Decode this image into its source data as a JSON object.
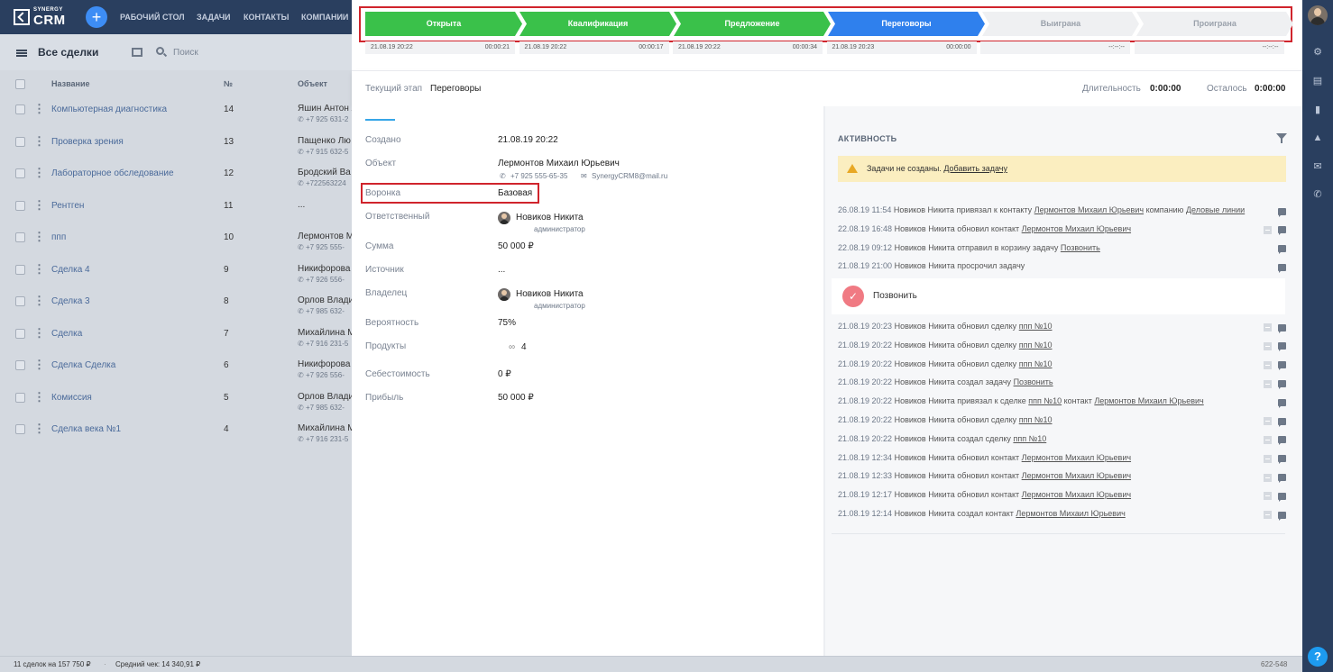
{
  "nav": {
    "logo_small": "SYNERGY",
    "logo_big": "CRM",
    "items": [
      "РАБОЧИЙ СТОЛ",
      "ЗАДАЧИ",
      "КОНТАКТЫ",
      "КОМПАНИИ"
    ]
  },
  "list": {
    "title": "Все сделки",
    "search_placeholder": "Поиск",
    "columns": [
      "Название",
      "№",
      "Объект"
    ],
    "rows": [
      {
        "name": "Компьютерная диагностика",
        "num": "14",
        "object": "Яшин Антон А",
        "phone": "+7 925 631-2"
      },
      {
        "name": "Проверка зрения",
        "num": "13",
        "object": "Пащенко Лю",
        "phone": "+7 915 632-5"
      },
      {
        "name": "Лабораторное обследование",
        "num": "12",
        "object": "Бродский Ва",
        "phone": "+722563224"
      },
      {
        "name": "Рентген",
        "num": "11",
        "object": "...",
        "phone": ""
      },
      {
        "name": "ппп",
        "num": "10",
        "object": "Лермонтов М",
        "phone": "+7 925 555-"
      },
      {
        "name": "Сделка 4",
        "num": "9",
        "object": "Никифорова",
        "phone": "+7 926 556-"
      },
      {
        "name": "Сделка 3",
        "num": "8",
        "object": "Орлов Влади",
        "phone": "+7 985 632-"
      },
      {
        "name": "Сделка",
        "num": "7",
        "object": "Михайлина М",
        "phone": "+7 916 231-5"
      },
      {
        "name": "Сделка Сделка",
        "num": "6",
        "object": "Никифорова",
        "phone": "+7 926 556-"
      },
      {
        "name": "Комиссия",
        "num": "5",
        "object": "Орлов Влади",
        "phone": "+7 985 632-"
      },
      {
        "name": "Сделка века №1",
        "num": "4",
        "object": "Михайлина М",
        "phone": "+7 916 231-5"
      }
    ]
  },
  "footer": {
    "summary": "11 сделок на 157 750 ₽",
    "separator": "·",
    "average": "Средний чек: 14 340,91 ₽",
    "right": "622-548"
  },
  "stages": [
    {
      "label": "Открыта",
      "time": "21.08.19 20:22",
      "duration": "00:00:21",
      "color": "#3ac14a",
      "state": "done"
    },
    {
      "label": "Квалификация",
      "time": "21.08.19 20:22",
      "duration": "00:00:17",
      "color": "#3ac14a",
      "state": "done"
    },
    {
      "label": "Предложение",
      "time": "21.08.19 20:22",
      "duration": "00:00:34",
      "color": "#3ac14a",
      "state": "done"
    },
    {
      "label": "Переговоры",
      "time": "21.08.19 20:23",
      "duration": "00:00:00",
      "color": "#2f80ed",
      "state": "current"
    },
    {
      "label": "Выиграна",
      "time": "",
      "duration": "--:--:--",
      "color": "#eff0f2",
      "state": "future"
    },
    {
      "label": "Проиграна",
      "time": "",
      "duration": "--:--:--",
      "color": "#eff0f2",
      "state": "future"
    }
  ],
  "stage_bar": {
    "current_label": "Текущий этап",
    "current_value": "Переговоры",
    "duration_label": "Длительность",
    "duration_value": "0:00:00",
    "left_label": "Осталось",
    "left_value": "0:00:00"
  },
  "details": {
    "created_label": "Создано",
    "created_value": "21.08.19 20:22",
    "object_label": "Объект",
    "object_value": "Лермонтов Михаил Юрьевич",
    "object_phone": "+7 925 555-65-35",
    "object_email": "SynergyCRM8@mail.ru",
    "funnel_label": "Воронка",
    "funnel_value": "Базовая",
    "responsible_label": "Ответственный",
    "responsible_value": "Новиков Никита",
    "responsible_role": "администратор",
    "sum_label": "Сумма",
    "sum_value": "50 000 ₽",
    "source_label": "Источник",
    "source_value": "...",
    "owner_label": "Владелец",
    "owner_value": "Новиков Никита",
    "owner_role": "администратор",
    "probability_label": "Вероятность",
    "probability_value": "75%",
    "products_label": "Продукты",
    "products_value": "4",
    "cost_label": "Себестоимость",
    "cost_value": "0 ₽",
    "profit_label": "Прибыль",
    "profit_value": "50 000 ₽"
  },
  "activity": {
    "title": "АКТИВНОСТЬ",
    "warning_text": "Задачи не созданы.",
    "warning_link": "Добавить задачу",
    "task_label": "Позвонить",
    "items_top": [
      {
        "date": "26.08.19 11:54",
        "text": "Новиков Никита привязал к контакту",
        "link1": "Лермонтов Михаил Юрьевич",
        "mid": "компанию",
        "link2": "Деловые линии",
        "plus": false
      },
      {
        "date": "22.08.19 16:48",
        "text": "Новиков Никита обновил контакт",
        "link1": "Лермонтов Михаил Юрьевич",
        "mid": "",
        "link2": "",
        "plus": true
      },
      {
        "date": "22.08.19 09:12",
        "text": "Новиков Никита отправил в корзину задачу",
        "link1": "Позвонить",
        "mid": "",
        "link2": "",
        "plus": false
      },
      {
        "date": "21.08.19 21:00",
        "text": "Новиков Никита просрочил задачу",
        "link1": "",
        "mid": "",
        "link2": "",
        "plus": false
      }
    ],
    "items_bottom": [
      {
        "date": "21.08.19 20:23",
        "text": "Новиков Никита обновил сделку",
        "link1": "ппп №10",
        "mid": "",
        "link2": "",
        "plus": true
      },
      {
        "date": "21.08.19 20:22",
        "text": "Новиков Никита обновил сделку",
        "link1": "ппп №10",
        "mid": "",
        "link2": "",
        "plus": true
      },
      {
        "date": "21.08.19 20:22",
        "text": "Новиков Никита обновил сделку",
        "link1": "ппп №10",
        "mid": "",
        "link2": "",
        "plus": true
      },
      {
        "date": "21.08.19 20:22",
        "text": "Новиков Никита создал задачу",
        "link1": "Позвонить",
        "mid": "",
        "link2": "",
        "plus": true
      },
      {
        "date": "21.08.19 20:22",
        "text": "Новиков Никита привязал к сделке",
        "link1": "ппп №10",
        "mid": "контакт",
        "link2": "Лермонтов Михаил Юрьевич",
        "plus": false
      },
      {
        "date": "21.08.19 20:22",
        "text": "Новиков Никита обновил сделку",
        "link1": "ппп №10",
        "mid": "",
        "link2": "",
        "plus": true
      },
      {
        "date": "21.08.19 20:22",
        "text": "Новиков Никита создал сделку",
        "link1": "ппп №10",
        "mid": "",
        "link2": "",
        "plus": true
      },
      {
        "date": "21.08.19 12:34",
        "text": "Новиков Никита обновил контакт",
        "link1": "Лермонтов Михаил Юрьевич",
        "mid": "",
        "link2": "",
        "plus": true
      },
      {
        "date": "21.08.19 12:33",
        "text": "Новиков Никита обновил контакт",
        "link1": "Лермонтов Михаил Юрьевич",
        "mid": "",
        "link2": "",
        "plus": true
      },
      {
        "date": "21.08.19 12:17",
        "text": "Новиков Никита обновил контакт",
        "link1": "Лермонтов Михаил Юрьевич",
        "mid": "",
        "link2": "",
        "plus": true
      },
      {
        "date": "21.08.19 12:14",
        "text": "Новиков Никита создал контакт",
        "link1": "Лермонтов Михаил Юрьевич",
        "mid": "",
        "link2": "",
        "plus": true
      }
    ]
  },
  "sidebar_icons": [
    "gear-icon",
    "book-icon",
    "chat-icon",
    "bell-icon",
    "mail-icon",
    "phone-icon"
  ],
  "help_label": "?"
}
